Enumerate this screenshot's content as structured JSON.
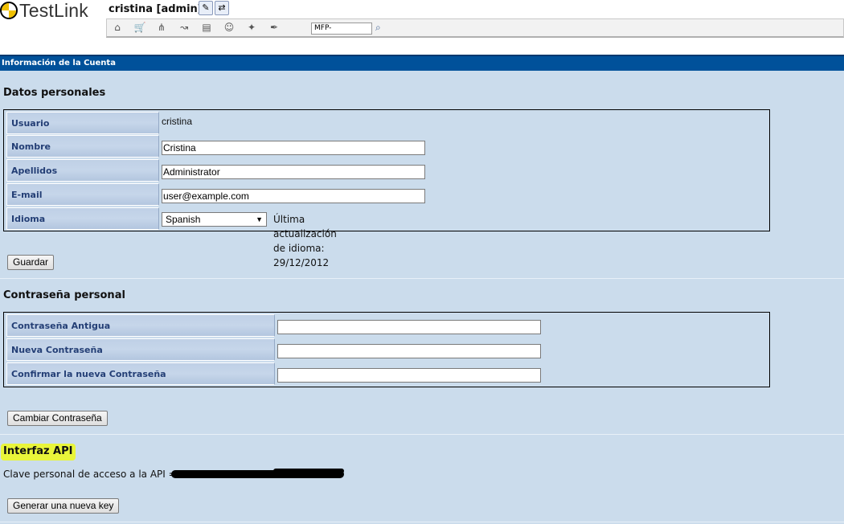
{
  "header": {
    "logo_text": "TestLink",
    "user_label": "cristina [admin]",
    "search_value": "MFP-",
    "icons": [
      "home-icon",
      "cart-icon",
      "tree-icon",
      "flow-icon",
      "document-icon",
      "user-icon",
      "magic-icon",
      "pen-icon"
    ]
  },
  "title_bar": {
    "text": "Información de la Cuenta",
    "color": "#00519a"
  },
  "personal": {
    "heading": "Datos personales",
    "fields": {
      "usuario": {
        "label": "Usuario",
        "value": "cristina"
      },
      "nombre": {
        "label": "Nombre",
        "value": "Cristina"
      },
      "apellidos": {
        "label": "Apellidos",
        "value": "Administrator"
      },
      "email": {
        "label": "E-mail",
        "value": "user@example.com"
      },
      "idioma": {
        "label": "Idioma",
        "value": "Spanish",
        "update_text": "Última actualización de idioma: 29/12/2012"
      }
    },
    "save_button": "Guardar"
  },
  "password": {
    "heading": "Contraseña personal",
    "fields": {
      "old": {
        "label": "Contraseña Antigua",
        "value": ""
      },
      "new": {
        "label": "Nueva Contraseña",
        "value": ""
      },
      "confirm": {
        "label": "Confirmar la nueva Contraseña",
        "value": ""
      }
    },
    "change_button": "Cambiar Contraseña"
  },
  "api": {
    "heading": "Interfaz API",
    "key_label": "Clave personal de acceso a la API =",
    "generate_button": "Generar una nueva key",
    "highlight_color": "#e9f53a"
  }
}
